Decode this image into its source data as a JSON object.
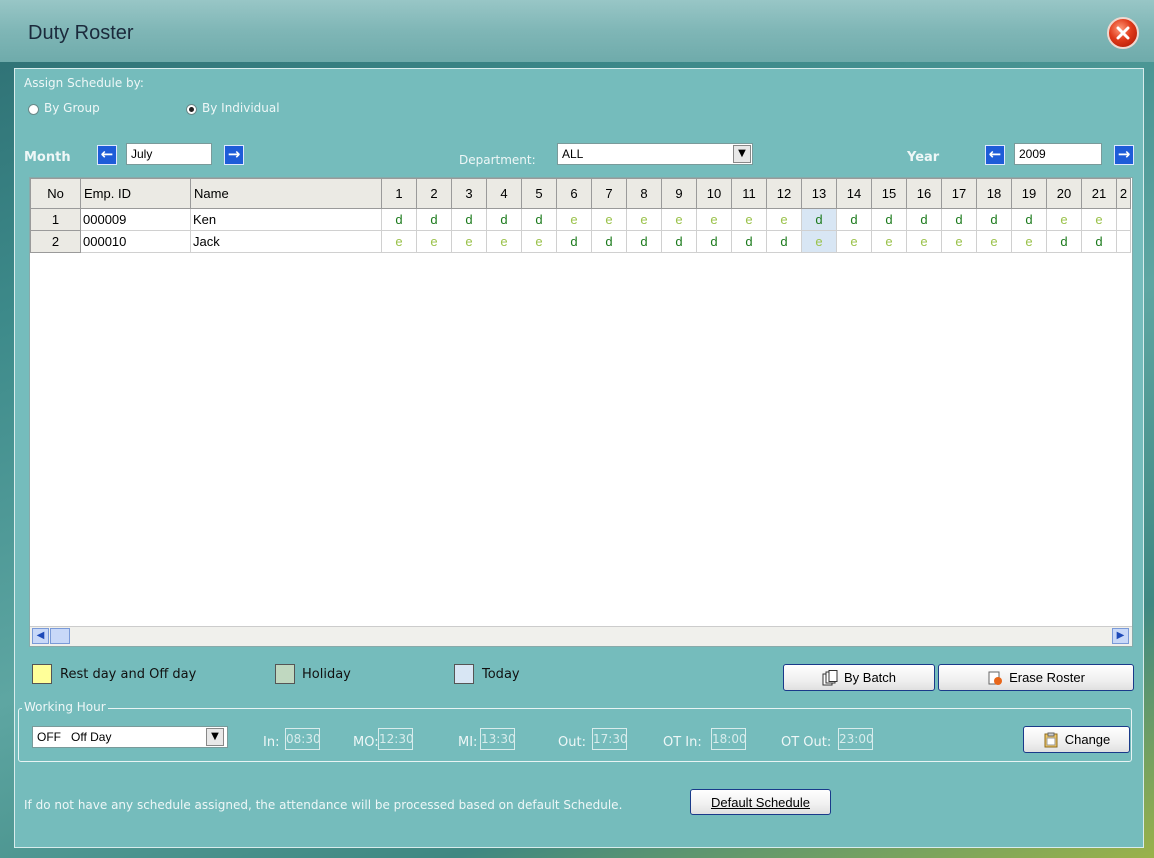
{
  "window": {
    "title": "Duty Roster"
  },
  "assign": {
    "label": "Assign Schedule by:",
    "by_group": "By Group",
    "by_individual": "By Individual",
    "selected": "By Individual"
  },
  "month": {
    "label": "Month",
    "value": "July"
  },
  "department": {
    "label": "Department:",
    "value": "ALL"
  },
  "year": {
    "label": "Year",
    "value": "2009"
  },
  "table": {
    "headers": [
      "No",
      "Emp. ID",
      "Name",
      "1",
      "2",
      "3",
      "4",
      "5",
      "6",
      "7",
      "8",
      "9",
      "10",
      "11",
      "12",
      "13",
      "14",
      "15",
      "16",
      "17",
      "18",
      "19",
      "20",
      "21",
      "2"
    ],
    "rows": [
      {
        "no": "1",
        "emp_id": "000009",
        "name": "Ken",
        "days": [
          "d",
          "d",
          "d",
          "d",
          "d",
          "e",
          "e",
          "e",
          "e",
          "e",
          "e",
          "e",
          "d",
          "d",
          "d",
          "d",
          "d",
          "d",
          "d",
          "e",
          "e"
        ]
      },
      {
        "no": "2",
        "emp_id": "000010",
        "name": "Jack",
        "days": [
          "e",
          "e",
          "e",
          "e",
          "e",
          "d",
          "d",
          "d",
          "d",
          "d",
          "d",
          "d",
          "e",
          "e",
          "e",
          "e",
          "e",
          "e",
          "e",
          "d",
          "d"
        ]
      }
    ],
    "today_column": 13
  },
  "legend": {
    "rest_day": "Rest day and Off day",
    "holiday": "Holiday",
    "today": "Today",
    "colors": {
      "rest_day": "#ffff99",
      "holiday": "#c0d8c0",
      "today": "#d8e6f4"
    }
  },
  "buttons": {
    "by_batch": "By Batch",
    "erase_roster": "Erase Roster",
    "change": "Change",
    "default_schedule": "Default Schedule"
  },
  "working_hour": {
    "label": "Working Hour",
    "shift_code": "OFF",
    "shift_name": "Off Day",
    "in_label": "In:",
    "in": "08:30",
    "mo_label": "MO:",
    "mo": "12:30",
    "mi_label": "MI:",
    "mi": "13:30",
    "out_label": "Out:",
    "out": "17:30",
    "ot_in_label": "OT In:",
    "ot_in": "18:00",
    "ot_out_label": "OT Out:",
    "ot_out": "23:00"
  },
  "footer_note": "If do not have any schedule assigned, the attendance will be processed based on default Schedule."
}
